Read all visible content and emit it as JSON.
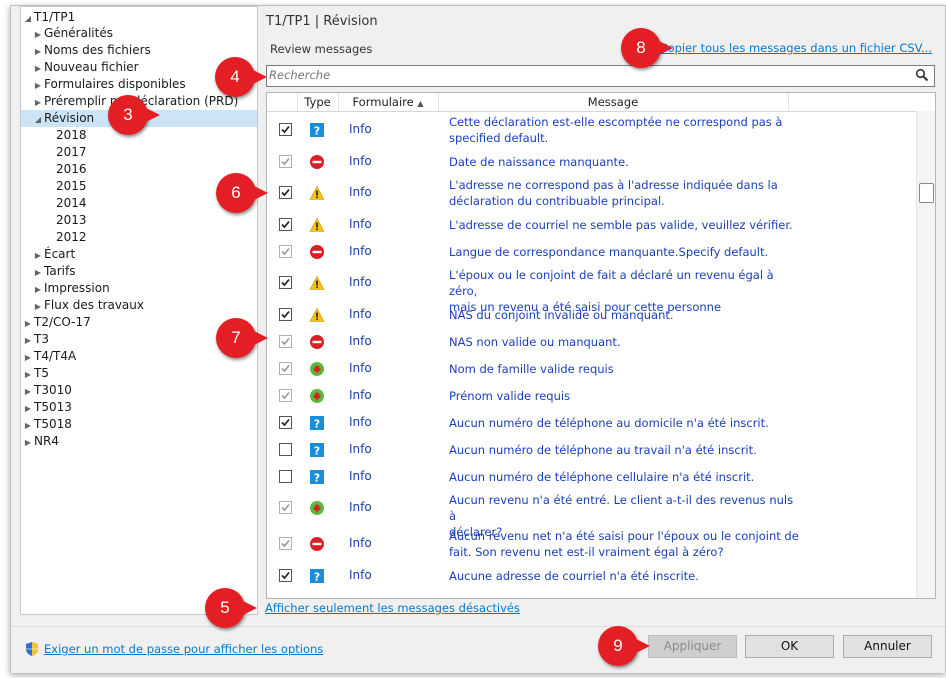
{
  "tree": {
    "root": "T1/TP1",
    "items": [
      {
        "label": "Généralités",
        "expandable": true
      },
      {
        "label": "Noms des fichiers",
        "expandable": true
      },
      {
        "label": "Nouveau fichier",
        "expandable": true
      },
      {
        "label": "Formulaires disponibles",
        "expandable": true
      },
      {
        "label": "Préremplir ma déclaration (PRD)",
        "expandable": true
      },
      {
        "label": "Révision",
        "expanded": true
      },
      {
        "label": "2018"
      },
      {
        "label": "2017"
      },
      {
        "label": "2016"
      },
      {
        "label": "2015"
      },
      {
        "label": "2014"
      },
      {
        "label": "2013"
      },
      {
        "label": "2012"
      },
      {
        "label": "Écart",
        "expandable": true
      },
      {
        "label": "Tarifs",
        "expandable": true
      },
      {
        "label": "Impression",
        "expandable": true
      },
      {
        "label": "Flux des travaux",
        "expandable": true
      }
    ],
    "top_items": [
      "T2/CO-17",
      "T3",
      "T4/T4A",
      "T5",
      "T3010",
      "T5013",
      "T5018",
      "NR4"
    ]
  },
  "crumb": "T1/TP1 | Révision",
  "review_label": "Review messages",
  "copy_link": "Copier tous les messages dans un fichier CSV...",
  "search_placeholder": "Recherche",
  "columns": {
    "type": "Type",
    "form": "Formulaire",
    "message": "Message"
  },
  "rows": [
    {
      "checked": true,
      "enabled": true,
      "icon": "question-icon",
      "form": "Info",
      "lines": [
        "Cette déclaration est-elle escomptée ne correspond pas à",
        "specified default."
      ]
    },
    {
      "checked": true,
      "enabled": false,
      "icon": "stop-icon",
      "form": "Info",
      "lines": [
        "Date de naissance manquante."
      ]
    },
    {
      "checked": true,
      "enabled": true,
      "icon": "warning-icon",
      "form": "Info",
      "lines": [
        "L'adresse ne correspond pas à l'adresse indiquée dans la",
        "déclaration du contribuable principal."
      ]
    },
    {
      "checked": true,
      "enabled": true,
      "icon": "warning-icon",
      "form": "Info",
      "lines": [
        "L'adresse de courriel ne semble pas valide, veuillez vérifier."
      ]
    },
    {
      "checked": true,
      "enabled": false,
      "icon": "stop-icon",
      "form": "Info",
      "lines": [
        "Langue de correspondance manquante.Specify default."
      ]
    },
    {
      "checked": true,
      "enabled": true,
      "icon": "warning-icon",
      "form": "Info",
      "lines": [
        "L'époux ou le conjoint de fait a déclaré un revenu égal à zéro,",
        "mais un revenu a été saisi pour cette personne"
      ]
    },
    {
      "checked": true,
      "enabled": true,
      "icon": "warning-icon",
      "form": "Info",
      "lines": [
        "NAS du conjoint invalide ou manquant."
      ]
    },
    {
      "checked": true,
      "enabled": false,
      "icon": "stop-icon",
      "form": "Info",
      "lines": [
        "NAS non valide ou manquant."
      ]
    },
    {
      "checked": true,
      "enabled": false,
      "icon": "maple-leaf-icon",
      "form": "Info",
      "lines": [
        "Nom de famille valide requis"
      ]
    },
    {
      "checked": true,
      "enabled": false,
      "icon": "maple-leaf-icon",
      "form": "Info",
      "lines": [
        "Prénom valide requis"
      ]
    },
    {
      "checked": true,
      "enabled": true,
      "icon": "question-icon",
      "form": "Info",
      "lines": [
        "Aucun numéro de téléphone au domicile n'a été inscrit."
      ]
    },
    {
      "checked": false,
      "enabled": true,
      "icon": "question-icon",
      "form": "Info",
      "lines": [
        "Aucun numéro de téléphone au travail n'a été inscrit."
      ]
    },
    {
      "checked": false,
      "enabled": true,
      "icon": "question-icon",
      "form": "Info",
      "lines": [
        "Aucun numéro de téléphone cellulaire n'a été inscrit."
      ]
    },
    {
      "checked": true,
      "enabled": false,
      "icon": "maple-leaf-icon",
      "form": "Info",
      "lines": [
        "Aucun revenu n'a été entré. Le client a-t-il des revenus nuls à",
        "déclarer?"
      ]
    },
    {
      "checked": true,
      "enabled": false,
      "icon": "stop-icon",
      "form": "Info",
      "lines": [
        "Aucun revenu net n'a été saisi pour l'époux ou le conjoint de",
        "fait. Son revenu net est-il vraiment égal à zéro?"
      ]
    },
    {
      "checked": true,
      "enabled": true,
      "icon": "question-icon",
      "form": "Info",
      "lines": [
        "Aucune adresse de courriel n'a été inscrite."
      ]
    }
  ],
  "bottom_link": "Afficher seulement les messages désactivés",
  "password_link": "Exiger un mot de passe pour afficher les options",
  "buttons": {
    "apply": "Appliquer",
    "ok": "OK",
    "cancel": "Annuler"
  },
  "callouts": [
    "3",
    "4",
    "5",
    "6",
    "7",
    "8",
    "9"
  ],
  "colors": {
    "link": "#0b78c9",
    "message": "#1b3fb8",
    "callout": "#e31e24",
    "selection": "#cce4f7"
  }
}
